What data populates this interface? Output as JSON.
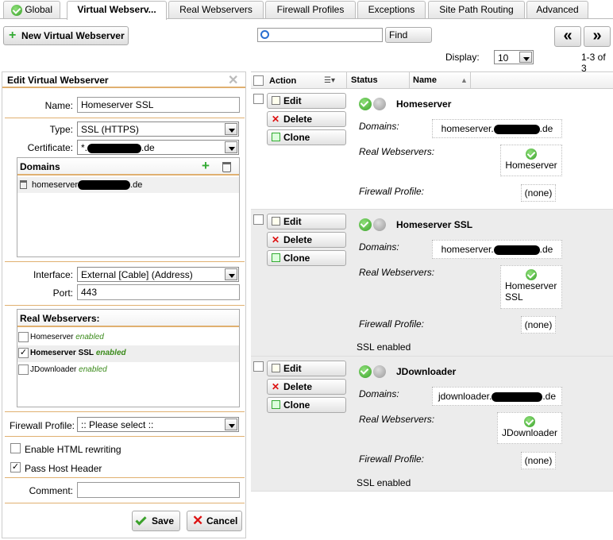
{
  "tabs": [
    {
      "label": "Global"
    },
    {
      "label": "Virtual Webserv..."
    },
    {
      "label": "Real Webservers"
    },
    {
      "label": "Firewall Profiles"
    },
    {
      "label": "Exceptions"
    },
    {
      "label": "Site Path Routing"
    },
    {
      "label": "Advanced"
    }
  ],
  "toolbar": {
    "new_label": "New Virtual Webserver",
    "search_value": "",
    "find_label": "Find",
    "prev_label": "«",
    "next_label": "»",
    "display_label": "Display:",
    "display_value": "10",
    "range_label": "1-3 of 3"
  },
  "editor": {
    "title": "Edit Virtual Webserver",
    "name_label": "Name:",
    "name_value": "Homeserver SSL",
    "type_label": "Type:",
    "type_value": "SSL (HTTPS)",
    "cert_label": "Certificate:",
    "cert_prefix": "*.",
    "cert_suffix": ".de",
    "domains_title": "Domains",
    "domain_prefix": "homeserver",
    "domain_suffix": ".de",
    "interface_label": "Interface:",
    "interface_value": "External [Cable] (Address)",
    "port_label": "Port:",
    "port_value": "443",
    "realws_title": "Real Webservers:",
    "realws": [
      {
        "name": "Homeserver",
        "status": "enabled",
        "checked": false
      },
      {
        "name": "Homeserver SSL",
        "status": "enabled",
        "checked": true
      },
      {
        "name": "JDownloader",
        "status": "enabled",
        "checked": false
      }
    ],
    "fwprofile_label": "Firewall Profile:",
    "fwprofile_value": ":: Please select ::",
    "html_rewrite_label": "Enable HTML rewriting",
    "pass_host_label": "Pass Host Header",
    "comment_label": "Comment:",
    "comment_value": "",
    "save_label": "Save",
    "cancel_label": "Cancel"
  },
  "list": {
    "col_action": "Action",
    "col_status": "Status",
    "col_name": "Name",
    "edit_label": "Edit",
    "delete_label": "Delete",
    "clone_label": "Clone",
    "domains_label": "Domains:",
    "realws_label": "Real Webservers:",
    "fw_label": "Firewall Profile:",
    "rows": [
      {
        "name": "Homeserver",
        "domain_prefix": "homeserver.",
        "domain_suffix": ".de",
        "realws_line1": "Homeserver",
        "realws_line2": "",
        "fw": "(none)",
        "extra": ""
      },
      {
        "name": "Homeserver SSL",
        "domain_prefix": "homeserver.",
        "domain_suffix": ".de",
        "realws_line1": "Homeserver",
        "realws_line2": "SSL",
        "fw": "(none)",
        "extra": "SSL enabled"
      },
      {
        "name": "JDownloader",
        "domain_prefix": "jdownloader.",
        "domain_suffix": ".de",
        "realws_line1": "JDownloader",
        "realws_line2": "",
        "fw": "(none)",
        "extra": "SSL enabled"
      }
    ]
  },
  "colors": {
    "accent": "#e0b070",
    "ok": "#3aa12a",
    "danger": "#d11111"
  }
}
